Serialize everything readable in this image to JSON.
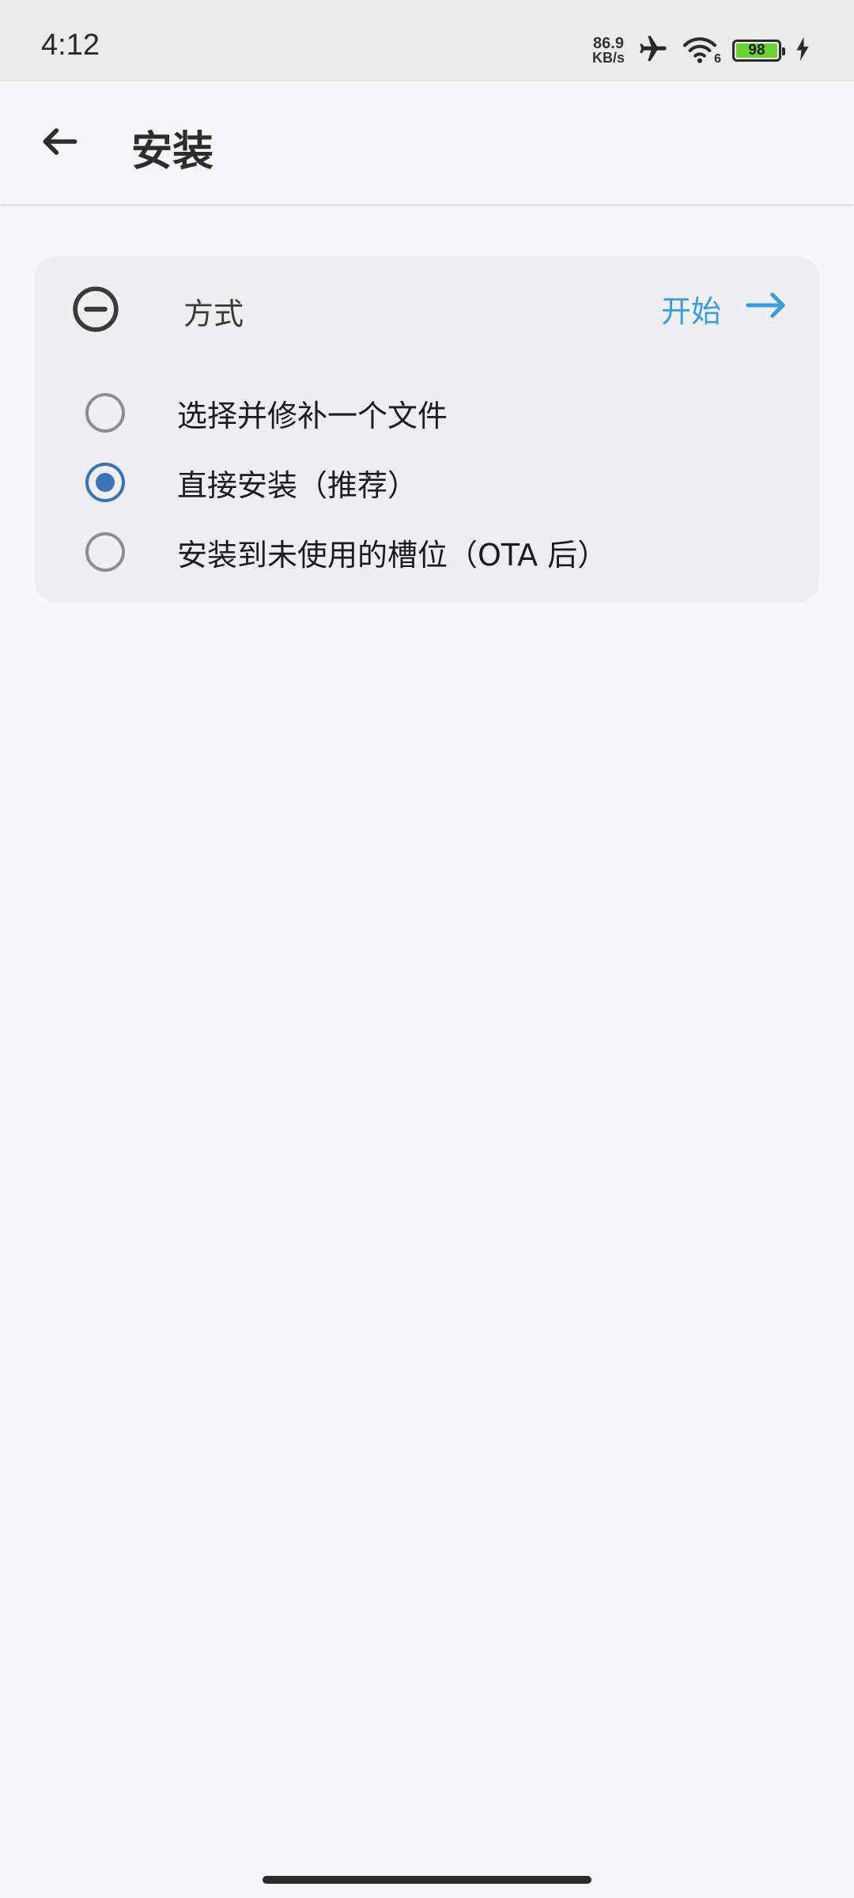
{
  "status_bar": {
    "time": "4:12",
    "net_speed_value": "86.9",
    "net_speed_unit": "KB/s",
    "wifi_label": "6",
    "battery_level": "98",
    "icons": [
      "airplane-icon",
      "wifi-icon",
      "battery-icon",
      "charging-icon"
    ]
  },
  "app_bar": {
    "title": "安装",
    "back_icon": "arrow-left-icon"
  },
  "card": {
    "title": "方式",
    "start_label": "开始",
    "collapse_icon": "minus-circle-icon",
    "start_icon": "arrow-right-icon",
    "accent_color": "#3a9de0",
    "options": [
      {
        "label": "选择并修补一个文件",
        "checked": false
      },
      {
        "label": "直接安装（推荐）",
        "checked": true
      },
      {
        "label": "安装到未使用的槽位（OTA 后）",
        "checked": false
      }
    ]
  },
  "colors": {
    "background": "#f7f7f9",
    "card": "#efeff1",
    "radio_checked": "#3a74b6",
    "battery_fill": "#6bd12f"
  }
}
